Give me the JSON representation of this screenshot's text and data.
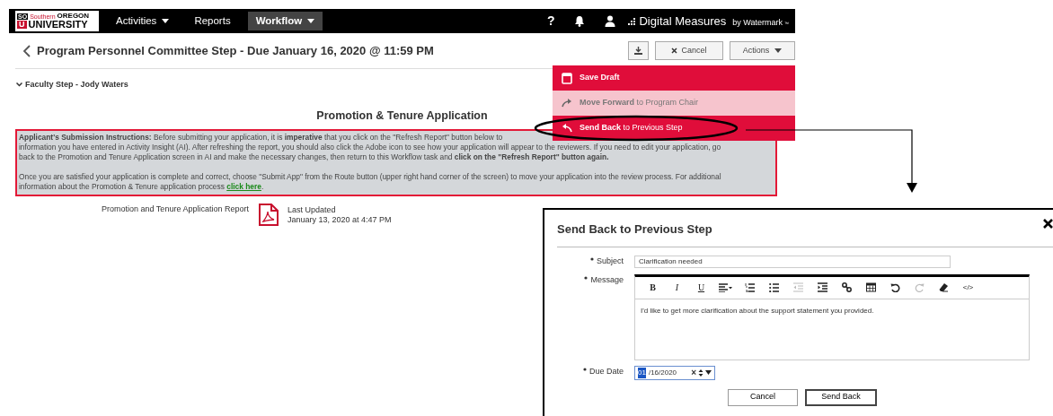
{
  "navbar": {
    "logo": {
      "mark_top": "SO",
      "word_1": "Southern",
      "word_2": "OREGON",
      "mark_bottom": "U",
      "word_3": "UNIVERSITY"
    },
    "menu": [
      {
        "label": "Activities",
        "dropdown": true,
        "selected": false
      },
      {
        "label": "Reports",
        "dropdown": false,
        "selected": false
      },
      {
        "label": "Workflow",
        "dropdown": true,
        "selected": true
      }
    ],
    "help": "?",
    "brand": {
      "name": "Digital Measures",
      "by": "by Watermark",
      "tm": "™"
    }
  },
  "header": {
    "title": "Program Personnel Committee Step - Due January 16, 2020 @ 11:59 PM",
    "buttons": [
      {
        "kind": "download"
      },
      {
        "kind": "cancel",
        "label": "Cancel"
      },
      {
        "kind": "actions",
        "label": "Actions"
      }
    ]
  },
  "actions_menu": [
    {
      "kind": "save",
      "text": "**Save Draft**",
      "disabled": false
    },
    {
      "kind": "forward",
      "text": "**Move Forward** to Program Chair",
      "disabled": true
    },
    {
      "kind": "back",
      "text": "**Send Back** to Previous Step",
      "disabled": false
    }
  ],
  "section": {
    "label": "Faculty Step - Jody Waters",
    "expanded": true
  },
  "application": {
    "title": "Promotion & Tenure Application",
    "instructions": [
      {
        "lines": [
          "**Applicant's Submission Instructions:** Before submitting your application, it is **imperative** that you click on the \"Refresh Report\" button below to",
          "information you have entered in Activity Insight (AI). After refreshing the report, you should also click the Adobe icon to see how your application will appear to the reviewers. If you need to edit your application, go",
          "back to the Promotion and Tenure Application screen in AI and make the necessary changes, then return to this Workflow task and **click on the \"Refresh Report\" button again.**"
        ]
      },
      {
        "lines": [
          "Once you are satisfied your application is complete and correct, choose \"Submit App\" from the Route button (upper right hand corner of the screen) to move your application into the review process. For additional",
          "information about the Promotion & Tenure application process"
        ],
        "link": "click here",
        "after_link": "."
      }
    ],
    "report": {
      "name": "Promotion and Tenure Application Report",
      "updated_label": "Last Updated",
      "updated": "January 13, 2020 at 4:47 PM"
    }
  },
  "dialog": {
    "title": "Send Back to Previous Step",
    "subject": {
      "label": "Subject",
      "required": true,
      "value": "Clarification needed"
    },
    "message": {
      "label": "Message",
      "required": true,
      "value": "I'd like to get more clarification about the support statement you provided.",
      "toolbar": [
        {
          "kind": "bold",
          "label": "B",
          "disabled": false
        },
        {
          "kind": "italic",
          "label": "I",
          "disabled": false
        },
        {
          "kind": "underline",
          "label": "U",
          "disabled": false
        },
        {
          "kind": "align",
          "disabled": false
        },
        {
          "kind": "ordered",
          "disabled": false
        },
        {
          "kind": "unordered",
          "disabled": false
        },
        {
          "kind": "outdent",
          "disabled": true
        },
        {
          "kind": "indent",
          "disabled": false
        },
        {
          "kind": "link",
          "disabled": false
        },
        {
          "kind": "table",
          "disabled": false
        },
        {
          "kind": "undo",
          "disabled": false
        },
        {
          "kind": "redo",
          "disabled": true
        },
        {
          "kind": "eraser",
          "disabled": false
        },
        {
          "kind": "code",
          "label": "</>",
          "disabled": false
        }
      ]
    },
    "due_date": {
      "label": "Due Date",
      "required": true,
      "month": "01",
      "month_selected": true,
      "rest": "/16/2020",
      "clear": "×"
    },
    "buttons": [
      {
        "label": "Cancel",
        "default": false
      },
      {
        "label": "Send Back",
        "default": true
      }
    ]
  }
}
